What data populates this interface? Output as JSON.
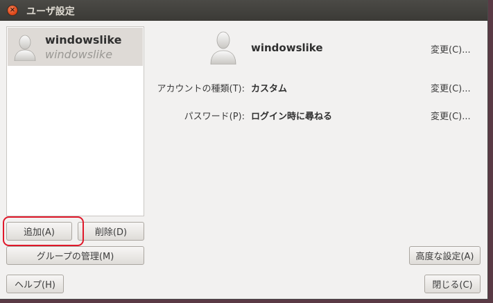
{
  "window": {
    "title": "ユーザ設定",
    "close_glyph": "×"
  },
  "user_list": {
    "items": [
      {
        "name": "windowslike",
        "subtitle": "windowslike"
      }
    ]
  },
  "buttons": {
    "add": "追加(A)",
    "delete": "削除(D)",
    "manage_groups": "グループの管理(M)",
    "advanced": "高度な設定(A)",
    "help": "ヘルプ(H)",
    "close": "閉じる(C)"
  },
  "details": {
    "name": "windowslike",
    "name_change": "変更(C)...",
    "account_type_label": "アカウントの種類(T):",
    "account_type_value": "カスタム",
    "account_type_change": "変更(C)...",
    "password_label": "パスワード(P):",
    "password_value": "ログイン時に尋ねる",
    "password_change": "変更(C)..."
  },
  "colors": {
    "highlight": "#e0182a",
    "close_button": "#e04a1c",
    "titlebar": "#3c3b37"
  }
}
